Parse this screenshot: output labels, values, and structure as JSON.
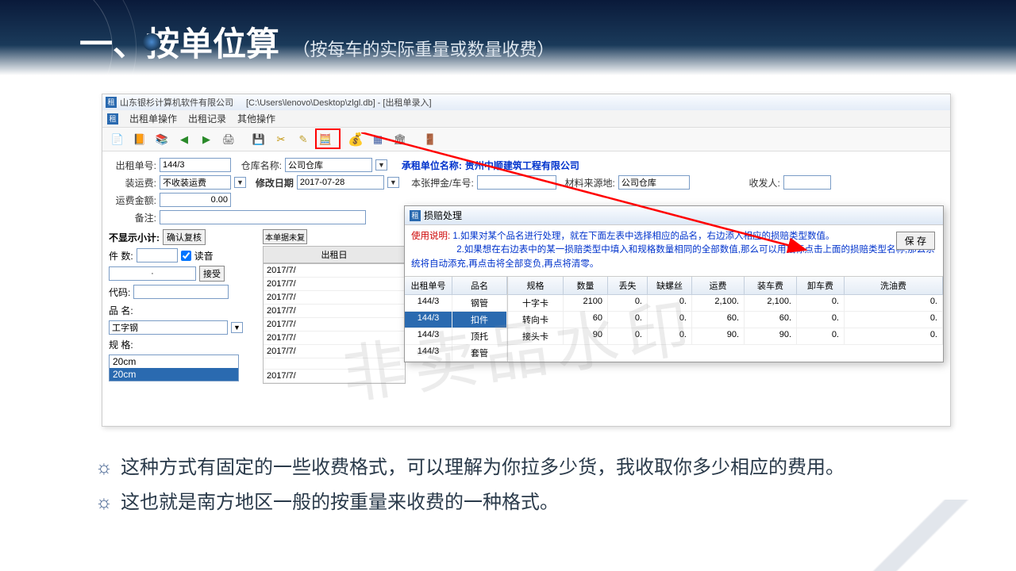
{
  "header": {
    "title": "一、按单位算",
    "subtitle": "（按每车的实际重量或数量收费）"
  },
  "titlebar": {
    "company": "山东银杉计算机软件有限公司",
    "path": "[C:\\Users\\lenovo\\Desktop\\zlgl.db] - [出租单录入]"
  },
  "menu": {
    "m1": "出租单操作",
    "m2": "出租记录",
    "m3": "其他操作"
  },
  "form": {
    "l_rentno": "出租单号:",
    "rentno": "144/3",
    "l_wh": "仓库名称:",
    "wh": "公司仓库",
    "l_tenant": "承租单位名称:",
    "tenant": "贵州中顺建筑工程有限公司",
    "l_ship": "装运费:",
    "ship": "不收装运费",
    "l_mdate": "修改日期",
    "mdate": "2017-07-28",
    "l_deposit": "本张押金/车号:",
    "deposit": "",
    "l_source": "材料来源地:",
    "source": "公司仓库",
    "l_receiver": "收发人:",
    "l_freight": "运费金额:",
    "freight": "0.00",
    "l_remark": "备注:"
  },
  "left": {
    "l_nosub": "不显示小计:",
    "confirm": "确认复核",
    "pending": "本单据未复",
    "l_count": "件 数:",
    "count_val": "·",
    "readaloud": "读音",
    "accept": "接受",
    "l_code": "代码:",
    "l_name": "品 名:",
    "name": "工字钢",
    "l_spec": "规 格:",
    "spec1": "20cm",
    "spec2": "20cm"
  },
  "dates": {
    "header": "出租日",
    "rows": [
      "2017/7/",
      "2017/7/",
      "2017/7/",
      "2017/7/",
      "2017/7/",
      "2017/7/",
      "2017/7/",
      "",
      "2017/7/"
    ]
  },
  "dialog": {
    "title": "损赔处理",
    "instr_label": "使用说明:",
    "instr1": "1.如果对某个品名进行处理，就在下面左表中选择相应的品名，右边添入相应的损赔类型数值。",
    "instr2": "2.如果想在右边表中的某一损赔类型中填入和规格数量相同的全部数值,那么可以用鼠标点击上面的损赔类型名称,那么系统将自动添充,再点击将全部变负,再点将清零。",
    "save": "保 存",
    "left_h1": "出租单号",
    "left_h2": "品名",
    "lrows": [
      {
        "no": "144/3",
        "name": "钢管"
      },
      {
        "no": "144/3",
        "name": "扣件"
      },
      {
        "no": "144/3",
        "name": "顶托"
      },
      {
        "no": "144/3",
        "name": "套管"
      }
    ],
    "rh": {
      "c1": "规格",
      "c2": "数量",
      "c3": "丢失",
      "c4": "缺螺丝",
      "c5": "运费",
      "c6": "装车费",
      "c7": "卸车费",
      "c8": "洗油费"
    },
    "rrows": [
      {
        "spec": "十字卡",
        "qty": "2100",
        "lost": "0.",
        "screw": "0.",
        "ship": "2,100.",
        "load": "2,100.",
        "unload": "0.",
        "oil": "0."
      },
      {
        "spec": "转向卡",
        "qty": "60",
        "lost": "0.",
        "screw": "0.",
        "ship": "60.",
        "load": "60.",
        "unload": "0.",
        "oil": "0."
      },
      {
        "spec": "接头卡",
        "qty": "90",
        "lost": "0.",
        "screw": "0.",
        "ship": "90.",
        "load": "90.",
        "unload": "0.",
        "oil": "0."
      }
    ]
  },
  "watermark": "非卖品水印",
  "bullets": {
    "b1": "这种方式有固定的一些收费格式，可以理解为你拉多少货，我收取你多少相应的费用。",
    "b2": "这也就是南方地区一般的按重量来收费的一种格式。"
  }
}
